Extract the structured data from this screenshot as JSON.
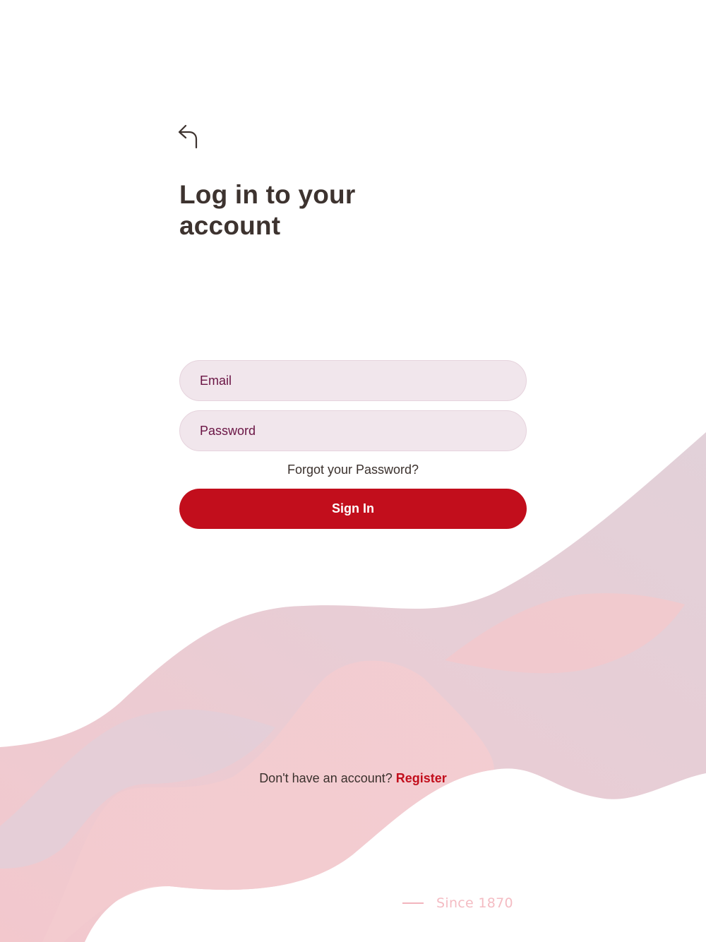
{
  "header": {
    "back_icon": "back-arrow-icon",
    "title": "Log in to your account"
  },
  "form": {
    "email_placeholder": "Email",
    "password_placeholder": "Password",
    "forgot_label": "Forgot your Password?",
    "sign_in_label": "Sign In"
  },
  "footer": {
    "register_prompt": "Don't have an account?",
    "register_label": "Register",
    "since_label": "Since 1870"
  },
  "colors": {
    "accent": "#c20e1c",
    "title_text": "#3d332f",
    "field_background": "#f1e6ec",
    "field_text": "#6a1444",
    "wave_pink": "#f4c9cd",
    "wave_mauve": "#e3d1d9"
  }
}
